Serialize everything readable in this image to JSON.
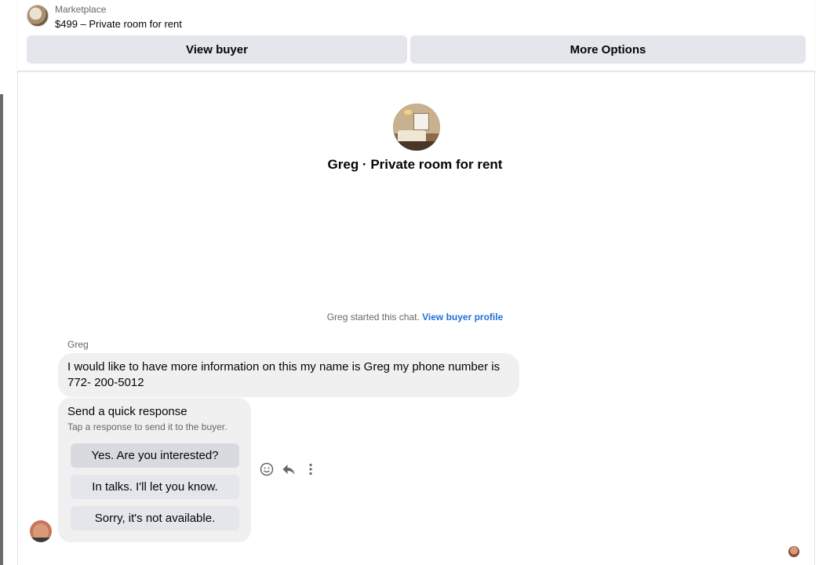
{
  "header": {
    "marketplace_label": "Marketplace",
    "listing_title": "$499 – Private room for rent",
    "view_buyer_label": "View buyer",
    "more_options_label": "More Options"
  },
  "conversation": {
    "title": "Greg · Private room for rent",
    "started_text": "Greg started this chat. ",
    "view_buyer_profile_label": "View buyer profile"
  },
  "message": {
    "sender": "Greg",
    "text": "I would like to have more information on this my name is Greg my phone number is 772- 200-5012"
  },
  "quick_response": {
    "title": "Send a quick response",
    "subtitle": "Tap a response to send it to the buyer.",
    "options": [
      "Yes. Are you interested?",
      "In talks. I'll let you know.",
      "Sorry, it's not available."
    ]
  },
  "message_actions": {
    "icons": [
      "emoji-icon",
      "reply-icon",
      "more-icon"
    ]
  },
  "colors": {
    "link": "#216fdb",
    "button_bg": "#e4e6eb",
    "bubble_bg": "#f0f0f0",
    "secondary_text": "#65676b"
  }
}
